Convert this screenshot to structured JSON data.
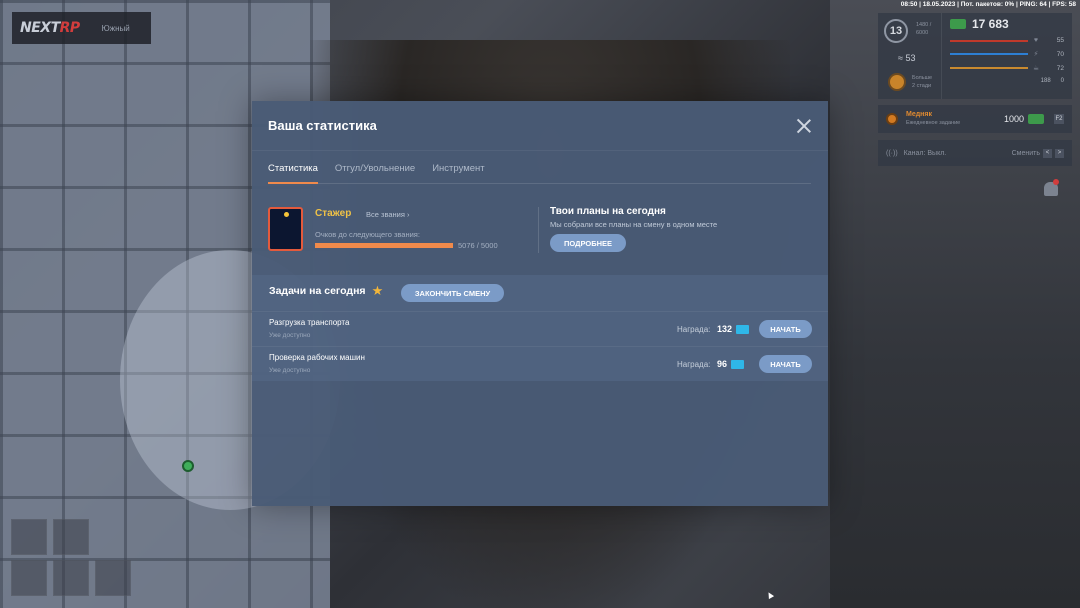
{
  "hud": {
    "logo_brand_a": "NEXT",
    "logo_brand_b": "RP",
    "server": "Южный",
    "status_line": "08:50 | 18.05.2023 | Пот. пакетов: 0% | PING: 64 | FPS: 58",
    "level": "13",
    "exp_a": "1480 /",
    "exp_b": "6000",
    "wanted": "53",
    "rank_a": "Больше",
    "rank_b": "2 стади",
    "money": "17 683",
    "stats": [
      {
        "icon": "♥",
        "value": "55",
        "color": "#c0392b"
      },
      {
        "icon": "⚡",
        "value": "70",
        "color": "#2d7fd4"
      },
      {
        "icon": "☕",
        "value": "72",
        "color": "#c98a2f"
      }
    ],
    "bottom_a": "188",
    "bottom_b": "0",
    "task_name": "Медняк",
    "task_sub": "Ежедневное задание",
    "task_amount": "1000",
    "task_key": "F2",
    "radio_label": "Канал:",
    "radio_state": "Выкл.",
    "radio_switch": "Сменить",
    "radio_key_left": "<",
    "radio_key_right": ">"
  },
  "modal": {
    "title": "Ваша статистика",
    "tabs": [
      "Статистика",
      "Отгул/Увольнение",
      "Инструмент"
    ],
    "rank_name": "Стажер",
    "all_ranks": "Все звания ›",
    "points_label": "Очков до следующего звания:",
    "progress_current": 5076,
    "progress_total": 5000,
    "progress_text": "5076 / 5000",
    "plans_title": "Твои планы на сегодня",
    "plans_sub": "Мы собрали все планы на смену в одном месте",
    "plans_button": "ПОДРОБНЕЕ",
    "tasks_title": "Задачи на сегодня",
    "finish_button": "ЗАКОНЧИТЬ СМЕНУ",
    "tasks": [
      {
        "name": "Разгрузка транспорта",
        "status": "Уже доступно",
        "reward_label": "Награда:",
        "reward": "132",
        "button": "НАЧАТЬ"
      },
      {
        "name": "Проверка рабочих машин",
        "status": "Уже доступно",
        "reward_label": "Награда:",
        "reward": "96",
        "button": "НАЧАТЬ"
      }
    ]
  }
}
